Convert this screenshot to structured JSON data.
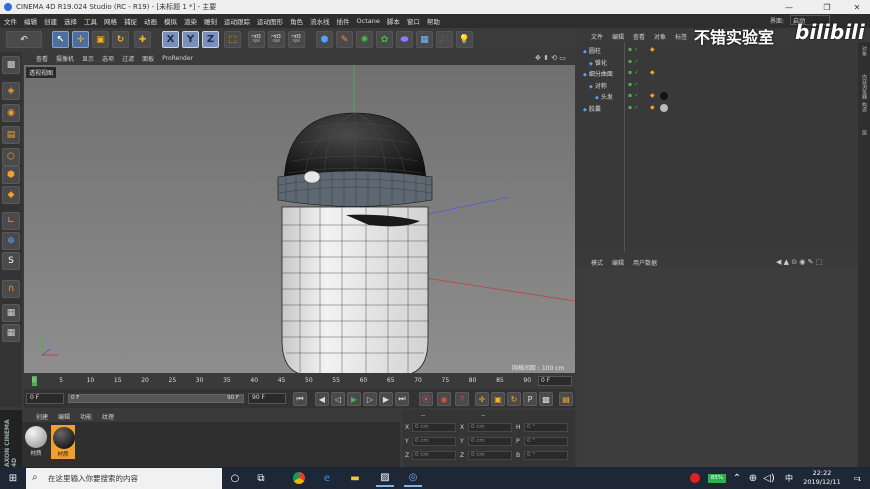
{
  "window": {
    "title": "CINEMA 4D R19.024 Studio (RC - R19) - [未标题 1 *] - 主要",
    "minimize": "—",
    "restore": "❐",
    "close": "✕",
    "layout_label": "界面:",
    "layout_value": "启动"
  },
  "menubar": [
    "文件",
    "编辑",
    "创建",
    "选择",
    "工具",
    "网格",
    "捕捉",
    "动画",
    "模拟",
    "渲染",
    "雕刻",
    "运动跟踪",
    "运动图形",
    "角色",
    "流水线",
    "插件",
    "Octane",
    "脚本",
    "窗口",
    "帮助"
  ],
  "viewport": {
    "menu": [
      "查看",
      "摄像机",
      "显示",
      "选项",
      "过滤",
      "面板",
      "ProRender"
    ],
    "label": "透视视图",
    "grid_spacing": "网格间距 : 100 cm"
  },
  "timeline": {
    "ticks": [
      "0",
      "5",
      "10",
      "15",
      "20",
      "25",
      "30",
      "35",
      "40",
      "45",
      "50",
      "55",
      "60",
      "65",
      "70",
      "75",
      "80",
      "85",
      "90"
    ],
    "frame_end_label": "0 F",
    "current_frame": "0 F",
    "start_frame": "0 F",
    "range_end": "90 F",
    "end_frame": "90 F"
  },
  "materials": {
    "menu": [
      "创建",
      "编辑",
      "功能",
      "纹理"
    ],
    "items": [
      {
        "label": "材质",
        "color": "#b8b8b8"
      },
      {
        "label": "材质",
        "color": "#111111"
      }
    ]
  },
  "coords": {
    "header_a": "--",
    "header_b": "--",
    "rows": [
      {
        "a": "X",
        "av": "0 cm",
        "b": "X",
        "bv": "0 cm",
        "c": "H",
        "cv": "0 °"
      },
      {
        "a": "Y",
        "av": "0 cm",
        "b": "Y",
        "bv": "0 cm",
        "c": "P",
        "cv": "0 °"
      },
      {
        "a": "Z",
        "av": "0 cm",
        "b": "Z",
        "bv": "0 cm",
        "c": "B",
        "cv": "0 °"
      }
    ]
  },
  "object_manager": {
    "menu": [
      "文件",
      "编辑",
      "查看",
      "对象",
      "标签",
      "书签"
    ],
    "objects": [
      {
        "name": "圆柱",
        "indent": 0
      },
      {
        "name": "锥化",
        "indent": 1
      },
      {
        "name": "细分曲面",
        "indent": 0
      },
      {
        "name": "对称",
        "indent": 1
      },
      {
        "name": "头发",
        "indent": 2
      },
      {
        "name": "胶囊",
        "indent": 0
      }
    ]
  },
  "attributes": {
    "menu": [
      "模式",
      "编辑",
      "用户数据"
    ]
  },
  "right_tabs": [
    "对象",
    "内容浏览器",
    "构造",
    "层"
  ],
  "watermark": {
    "text": "不错实验室",
    "logo": "bilibili"
  },
  "maxon": "AXON CINEMA 4D",
  "taskbar": {
    "search_placeholder": "在这里输入你要搜索的内容",
    "battery": "85%",
    "ime": "中",
    "time": "22:22",
    "date": "2019/12/11",
    "notification_count": "1"
  },
  "colors": {
    "accent": "#4e6f9c",
    "viewport_bg": "#7f7f7f",
    "taskbar_bg": "#1e2736"
  }
}
